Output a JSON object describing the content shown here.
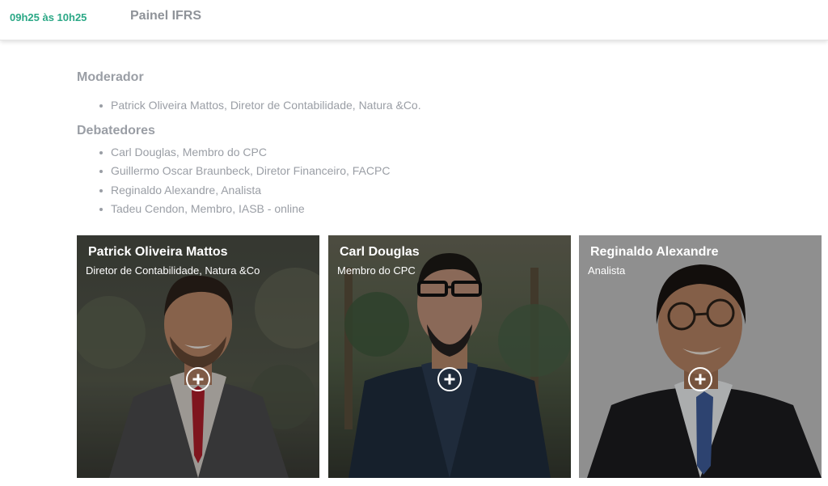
{
  "header": {
    "time": "09h25 às 10h25",
    "title": "Painel IFRS"
  },
  "moderator": {
    "heading": "Moderador",
    "items": [
      "Patrick Oliveira Mattos, Diretor de Contabilidade, Natura &Co."
    ]
  },
  "debaters": {
    "heading": "Debatedores",
    "items": [
      "Carl Douglas, Membro do CPC",
      "Guillermo Oscar Braunbeck, Diretor Financeiro, FACPC",
      "Reginaldo Alexandre, Analista",
      "Tadeu Cendon, Membro, IASB - online"
    ]
  },
  "cards": [
    {
      "name": "Patrick Oliveira Mattos",
      "role": "Diretor de Contabilidade, Natura &Co",
      "action_icon": "plus-circle-icon"
    },
    {
      "name": "Carl Douglas",
      "role": "Membro do CPC",
      "action_icon": "plus-circle-icon"
    },
    {
      "name": "Reginaldo Alexandre",
      "role": "Analista",
      "action_icon": "plus-circle-icon"
    }
  ],
  "colors": {
    "accent": "#2ba886",
    "muted_text": "#9a9ea5"
  }
}
